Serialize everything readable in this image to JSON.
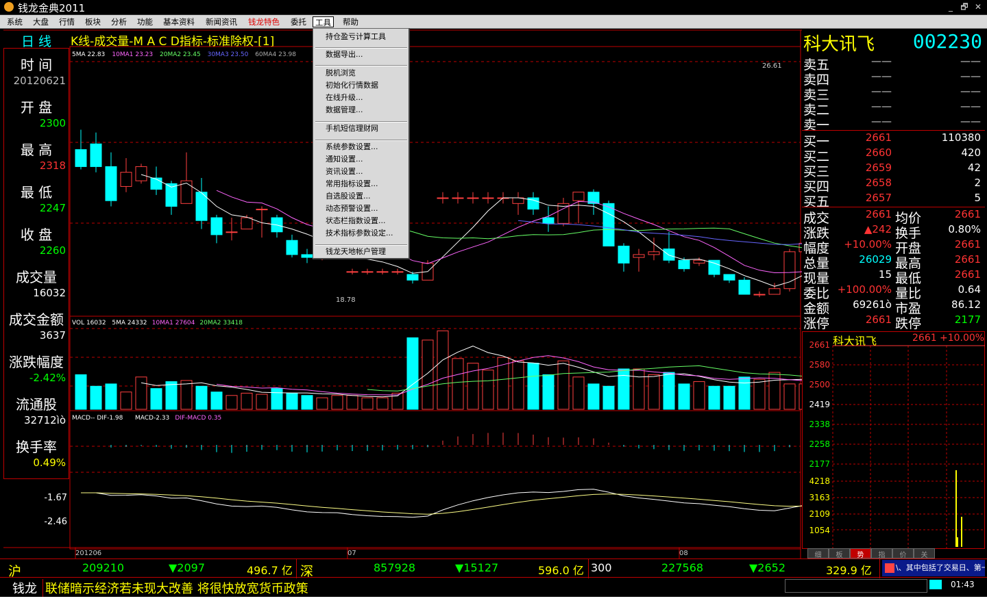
{
  "window": {
    "title": "钱龙金典2011",
    "buttons": [
      "_",
      "🗗",
      "✕"
    ]
  },
  "menu": {
    "items": [
      "系统",
      "大盘",
      "行情",
      "板块",
      "分析",
      "功能",
      "基本资料",
      "新闻资讯",
      "钱龙特色",
      "委托",
      "工具",
      "帮助"
    ]
  },
  "tools_menu": {
    "items": [
      "持仓盈亏计算工具",
      "数据导出...",
      "脱机浏览",
      "初始化行情数据",
      "在线升级...",
      "数据管理...",
      "手机短信理财网",
      "系统参数设置...",
      "通知设置...",
      "资讯设置...",
      "常用指标设置...",
      "自选股设置...",
      "动态预警设置...",
      "状态栏指数设置...",
      "技术指标参数设定...",
      "钱龙天地帐户管理"
    ]
  },
  "chart_header": {
    "period": "日 线",
    "title": "K线-成交量-M A C D指标-标准除权-[1]"
  },
  "ma_legend": [
    {
      "text": "5MA 22.83",
      "color": "#ffffff"
    },
    {
      "text": "10MA1 23.23",
      "color": "#ff66ff"
    },
    {
      "text": "20MA2 23.45",
      "color": "#66ff66"
    },
    {
      "text": "30MA3 23.50",
      "color": "#6666ff"
    },
    {
      "text": "60MA4 23.98",
      "color": "#aaaaaa"
    }
  ],
  "vol_legend": [
    {
      "text": "VOL 16032",
      "color": "#ffffff"
    },
    {
      "text": "5MA 24332",
      "color": "#ffffff"
    },
    {
      "text": "10MA1 27604",
      "color": "#ff66ff"
    },
    {
      "text": "20MA2 33418",
      "color": "#66ff66"
    }
  ],
  "macd_legend": [
    {
      "text": "MACD-- DIF-1.98",
      "color": "#ffffff"
    },
    {
      "text": "MACD-2.33",
      "color": "#ffffff"
    },
    {
      "text": "DIF-MACD 0.35",
      "color": "#ff66ff"
    }
  ],
  "price_labels": {
    "high": "26.61",
    "low": "18.78"
  },
  "macd_axis": [
    "-1.67",
    "-2.46"
  ],
  "x_labels": [
    "201206",
    "07",
    "08"
  ],
  "left_panel": [
    {
      "label": "时 间",
      "value": "20120621",
      "color": "#c0c0c0"
    },
    {
      "label": "开 盘",
      "value": "2300",
      "color": "#00ff00"
    },
    {
      "label": "最 高",
      "value": "2318",
      "color": "#ff3333"
    },
    {
      "label": "最 低",
      "value": "2247",
      "color": "#00ff00"
    },
    {
      "label": "收 盘",
      "value": "2260",
      "color": "#00ff00"
    },
    {
      "label": "成交量",
      "value": "16032",
      "color": "#ffffff"
    },
    {
      "label": "成交金额",
      "value": "3637",
      "color": "#ffffff"
    },
    {
      "label": "涨跌幅度",
      "value": "-2.42%",
      "color": "#00ff00"
    },
    {
      "label": "流通股",
      "value": "32712ìò",
      "color": "#ffffff"
    },
    {
      "label": "换手率",
      "value": "0.49%",
      "color": "#ffff00"
    }
  ],
  "stock": {
    "name": "科大讯飞",
    "code": "002230"
  },
  "sell_orders": [
    {
      "label": "卖五",
      "price": "——",
      "vol": "——"
    },
    {
      "label": "卖四",
      "price": "——",
      "vol": "——"
    },
    {
      "label": "卖三",
      "price": "——",
      "vol": "——"
    },
    {
      "label": "卖二",
      "price": "——",
      "vol": "——"
    },
    {
      "label": "卖一",
      "price": "——",
      "vol": "——"
    }
  ],
  "buy_orders": [
    {
      "label": "买一",
      "price": "2661",
      "vol": "110380"
    },
    {
      "label": "买二",
      "price": "2660",
      "vol": "420"
    },
    {
      "label": "买三",
      "price": "2659",
      "vol": "42"
    },
    {
      "label": "买四",
      "price": "2658",
      "vol": "2"
    },
    {
      "label": "买五",
      "price": "2657",
      "vol": "5"
    }
  ],
  "quote": [
    {
      "l1": "成交",
      "v1": "2661",
      "c1": "#ff3333",
      "l2": "均价",
      "v2": "2661",
      "c2": "#ff3333"
    },
    {
      "l1": "涨跌",
      "v1": "▲242",
      "c1": "#ff3333",
      "l2": "换手",
      "v2": "0.80%",
      "c2": "#ffffff"
    },
    {
      "l1": "幅度",
      "v1": "+10.00%",
      "c1": "#ff3333",
      "l2": "开盘",
      "v2": "2661",
      "c2": "#ff3333"
    },
    {
      "l1": "总量",
      "v1": "26029",
      "c1": "#00ffff",
      "l2": "最高",
      "v2": "2661",
      "c2": "#ff3333"
    },
    {
      "l1": "现量",
      "v1": "15",
      "c1": "#ffffff",
      "l2": "最低",
      "v2": "2661",
      "c2": "#ff3333"
    },
    {
      "l1": "委比",
      "v1": "+100.00%",
      "c1": "#ff3333",
      "l2": "量比",
      "v2": "0.64",
      "c2": "#ffffff"
    },
    {
      "l1": "金额",
      "v1": "69261ò",
      "c1": "#ffffff",
      "l2": "市盈",
      "v2": "86.12",
      "c2": "#ffffff"
    },
    {
      "l1": "涨停",
      "v1": "2661",
      "c1": "#ff3333",
      "l2": "跌停",
      "v2": "2177",
      "c2": "#00ff00"
    }
  ],
  "tick": {
    "name": "科大讯飞",
    "price": "2661",
    "change": "+10.00%",
    "price_axis": [
      "2661",
      "2580",
      "2500",
      "2419",
      "2338",
      "2258",
      "2177"
    ],
    "vol_axis": [
      "4218",
      "3163",
      "2109",
      "1054"
    ]
  },
  "mini_tabs": [
    "细",
    "板",
    "势",
    "指",
    "价",
    "关"
  ],
  "indices": [
    {
      "name": "沪",
      "value": "209210",
      "change": "▼2097",
      "amount": "496.7 亿"
    },
    {
      "name": "深",
      "value": "857928",
      "change": "▼15127",
      "amount": "596.0 亿"
    },
    {
      "name": "300",
      "value": "227568",
      "change": "▼2652",
      "amount": "329.9 亿"
    }
  ],
  "news": {
    "label": "钱龙",
    "text": "联储暗示经济若未现大改善 将很快放宽货币政策",
    "ticker": "\\、其中包括了交易日、第一财经",
    "clock": "01:43"
  },
  "chart_data": {
    "type": "candlestick",
    "title": "K线-成交量-M A C D指标-标准除权-[1]",
    "candles": [
      {
        "o": 23.5,
        "c": 22.9,
        "h": 24.2,
        "l": 22.8
      },
      {
        "o": 23.7,
        "c": 22.9,
        "h": 24.1,
        "l": 22.7
      },
      {
        "o": 22.9,
        "c": 21.7,
        "h": 23.4,
        "l": 21.5
      },
      {
        "o": 22.2,
        "c": 22.7,
        "h": 23.2,
        "l": 22.0
      },
      {
        "o": 22.4,
        "c": 22.9,
        "h": 23.0,
        "l": 22.3
      },
      {
        "o": 22.5,
        "c": 22.1,
        "h": 22.9,
        "l": 21.9
      },
      {
        "o": 22.3,
        "c": 21.5,
        "h": 22.4,
        "l": 21.2
      },
      {
        "o": 21.6,
        "c": 22.4,
        "h": 23.4,
        "l": 21.6
      },
      {
        "o": 22.0,
        "c": 21.0,
        "h": 22.5,
        "l": 20.7
      },
      {
        "o": 21.1,
        "c": 20.5,
        "h": 21.2,
        "l": 20.2
      },
      {
        "o": 20.6,
        "c": 20.6,
        "h": 21.1,
        "l": 20.3
      },
      {
        "o": 20.7,
        "c": 21.1,
        "h": 21.2,
        "l": 20.7
      },
      {
        "o": 21.4,
        "c": 21.4,
        "h": 21.5,
        "l": 20.4
      },
      {
        "o": 21.1,
        "c": 20.6,
        "h": 21.2,
        "l": 20.4
      },
      {
        "o": 20.3,
        "c": 19.8,
        "h": 20.5,
        "l": 19.7
      },
      {
        "o": 19.8,
        "c": 19.7,
        "h": 20.0,
        "l": 19.5
      },
      {
        "o": 19.8,
        "c": 20.0,
        "h": 20.2,
        "l": 19.6
      },
      {
        "o": 20.0,
        "c": 20.1,
        "h": 20.4,
        "l": 19.8
      },
      {
        "o": 19.2,
        "c": 19.2,
        "h": 19.3,
        "l": 19.1
      },
      {
        "o": 19.2,
        "c": 19.2,
        "h": 19.3,
        "l": 19.1
      },
      {
        "o": 19.2,
        "c": 19.2,
        "h": 19.3,
        "l": 19.1
      },
      {
        "o": 19.2,
        "c": 19.2,
        "h": 19.3,
        "l": 19.1
      },
      {
        "o": 19.1,
        "c": 18.9,
        "h": 19.2,
        "l": 18.78
      },
      {
        "o": 18.9,
        "c": 19.5,
        "h": 19.6,
        "l": 18.9
      },
      {
        "o": 21.8,
        "c": 21.8,
        "h": 22.0,
        "l": 21.6
      },
      {
        "o": 21.8,
        "c": 21.8,
        "h": 22.0,
        "l": 21.6
      },
      {
        "o": 21.8,
        "c": 21.8,
        "h": 22.0,
        "l": 21.6
      },
      {
        "o": 21.8,
        "c": 21.8,
        "h": 22.0,
        "l": 21.6
      },
      {
        "o": 21.8,
        "c": 21.8,
        "h": 22.0,
        "l": 21.6
      },
      {
        "o": 21.6,
        "c": 21.8,
        "h": 22.0,
        "l": 21.2
      },
      {
        "o": 21.8,
        "c": 21.4,
        "h": 22.0,
        "l": 21.2
      },
      {
        "o": 21.1,
        "c": 20.9,
        "h": 21.5,
        "l": 20.6
      },
      {
        "o": 20.9,
        "c": 21.6,
        "h": 21.8,
        "l": 20.8
      },
      {
        "o": 21.7,
        "c": 22.0,
        "h": 22.0,
        "l": 20.9
      },
      {
        "o": 22.0,
        "c": 21.6,
        "h": 22.1,
        "l": 21.2
      },
      {
        "o": 21.6,
        "c": 20.1,
        "h": 21.7,
        "l": 20.1
      },
      {
        "o": 20.1,
        "c": 19.5,
        "h": 20.2,
        "l": 19.2
      },
      {
        "o": 19.7,
        "c": 19.8,
        "h": 20.0,
        "l": 19.2
      },
      {
        "o": 19.8,
        "c": 19.9,
        "h": 20.4,
        "l": 19.6
      },
      {
        "o": 20.0,
        "c": 19.6,
        "h": 20.6,
        "l": 19.5
      },
      {
        "o": 19.6,
        "c": 19.3,
        "h": 19.7,
        "l": 19.2
      },
      {
        "o": 19.5,
        "c": 19.6,
        "h": 19.7,
        "l": 19.4
      },
      {
        "o": 19.6,
        "c": 19.1,
        "h": 19.6,
        "l": 19.0
      },
      {
        "o": 19.1,
        "c": 18.9,
        "h": 19.1,
        "l": 18.8
      },
      {
        "o": 18.9,
        "c": 18.4,
        "h": 19.0,
        "l": 18.4
      },
      {
        "o": 18.4,
        "c": 18.4,
        "h": 18.5,
        "l": 18.3
      },
      {
        "o": 18.4,
        "c": 18.6,
        "h": 18.8,
        "l": 18.4
      },
      {
        "o": 18.6,
        "c": 19.9,
        "h": 20.0,
        "l": 18.5
      },
      {
        "o": 19.9,
        "c": 20.2,
        "h": 20.8,
        "l": 19.8
      },
      {
        "o": 20.3,
        "c": 20.9,
        "h": 21.0,
        "l": 20.2
      },
      {
        "o": 21.0,
        "c": 22.3,
        "h": 22.6,
        "l": 20.9
      },
      {
        "o": 22.4,
        "c": 22.4,
        "h": 22.9,
        "l": 22.2
      },
      {
        "o": 22.6,
        "c": 23.0,
        "h": 23.4,
        "l": 22.4
      },
      {
        "o": 23.0,
        "c": 24.2,
        "h": 24.4,
        "l": 22.9
      },
      {
        "o": 24.2,
        "c": 26.6,
        "h": 26.6,
        "l": 24.2
      }
    ],
    "volumes": [
      30,
      20,
      22,
      15,
      28,
      18,
      24,
      25,
      20,
      15,
      12,
      14,
      13,
      18,
      14,
      12,
      10,
      12,
      12,
      10,
      10,
      14,
      62,
      60,
      68,
      44,
      40,
      34,
      45,
      42,
      40,
      30,
      42,
      28,
      22,
      20,
      35,
      35,
      30,
      32,
      22,
      24,
      20,
      20,
      28,
      26,
      32,
      22,
      22,
      30,
      28,
      30,
      20,
      32,
      26
    ],
    "ylabel": "",
    "xlabel": ""
  }
}
